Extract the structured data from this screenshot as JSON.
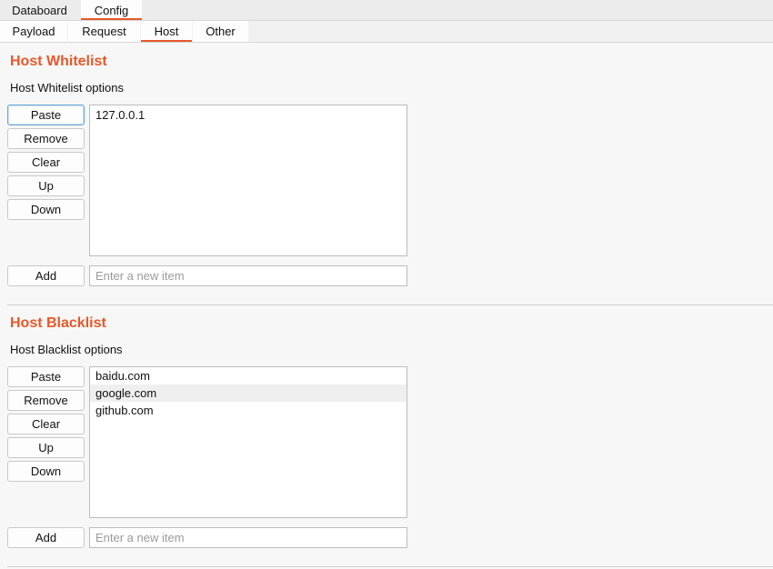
{
  "top_tabs": [
    {
      "label": "Databoard",
      "active": false
    },
    {
      "label": "Config",
      "active": true
    }
  ],
  "sub_tabs": [
    {
      "label": "Payload",
      "active": false
    },
    {
      "label": "Request",
      "active": false
    },
    {
      "label": "Host",
      "active": true
    },
    {
      "label": "Other",
      "active": false
    }
  ],
  "whitelist": {
    "title": "Host Whitelist",
    "subtitle": "Host Whitelist options",
    "buttons": {
      "paste": "Paste",
      "remove": "Remove",
      "clear": "Clear",
      "up": "Up",
      "down": "Down",
      "add": "Add"
    },
    "items": [
      "127.0.0.1"
    ],
    "input_placeholder": "Enter a new item",
    "input_value": ""
  },
  "blacklist": {
    "title": "Host Blacklist",
    "subtitle": "Host Blacklist options",
    "buttons": {
      "paste": "Paste",
      "remove": "Remove",
      "clear": "Clear",
      "up": "Up",
      "down": "Down",
      "add": "Add"
    },
    "items": [
      "baidu.com",
      "google.com",
      "github.com"
    ],
    "highlighted_index": 1,
    "input_placeholder": "Enter a new item",
    "input_value": ""
  },
  "colors": {
    "accent": "#e8582a",
    "focus": "#6aa6d6"
  }
}
